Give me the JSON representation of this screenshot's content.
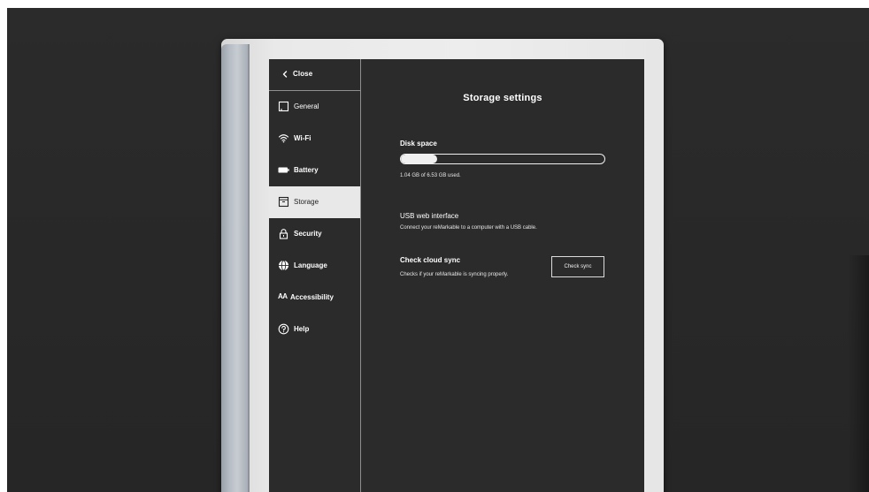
{
  "sidebar": {
    "close_label": "Close",
    "items": [
      {
        "label": "General",
        "icon": "square-icon",
        "active": false
      },
      {
        "label": "Wi-Fi",
        "icon": "wifi-icon",
        "active": false
      },
      {
        "label": "Battery",
        "icon": "battery-icon",
        "active": false
      },
      {
        "label": "Storage",
        "icon": "storage-box-icon",
        "active": true
      },
      {
        "label": "Security",
        "icon": "lock-icon",
        "active": false
      },
      {
        "label": "Language",
        "icon": "globe-icon",
        "active": false
      },
      {
        "label": "Accessibility",
        "icon": "text-size-icon",
        "icon_text": "AA",
        "active": false
      },
      {
        "label": "Help",
        "icon": "help-icon",
        "active": false
      }
    ]
  },
  "main": {
    "title": "Storage settings",
    "disk": {
      "title": "Disk space",
      "used_fraction": 0.18,
      "usage_text": "1.04 GB of 6.53 GB used."
    },
    "usb": {
      "title": "USB web interface",
      "description": "Connect your reMarkable to a computer with a USB cable."
    },
    "cloud_sync": {
      "title": "Check cloud sync",
      "description": "Checks if your reMarkable is syncing properly.",
      "button_label": "Check sync"
    }
  },
  "colors": {
    "backdrop": "#282828",
    "screen_background": "#2b2b2b",
    "active_item_background": "#e8e8e8",
    "text": "#ffffff"
  }
}
